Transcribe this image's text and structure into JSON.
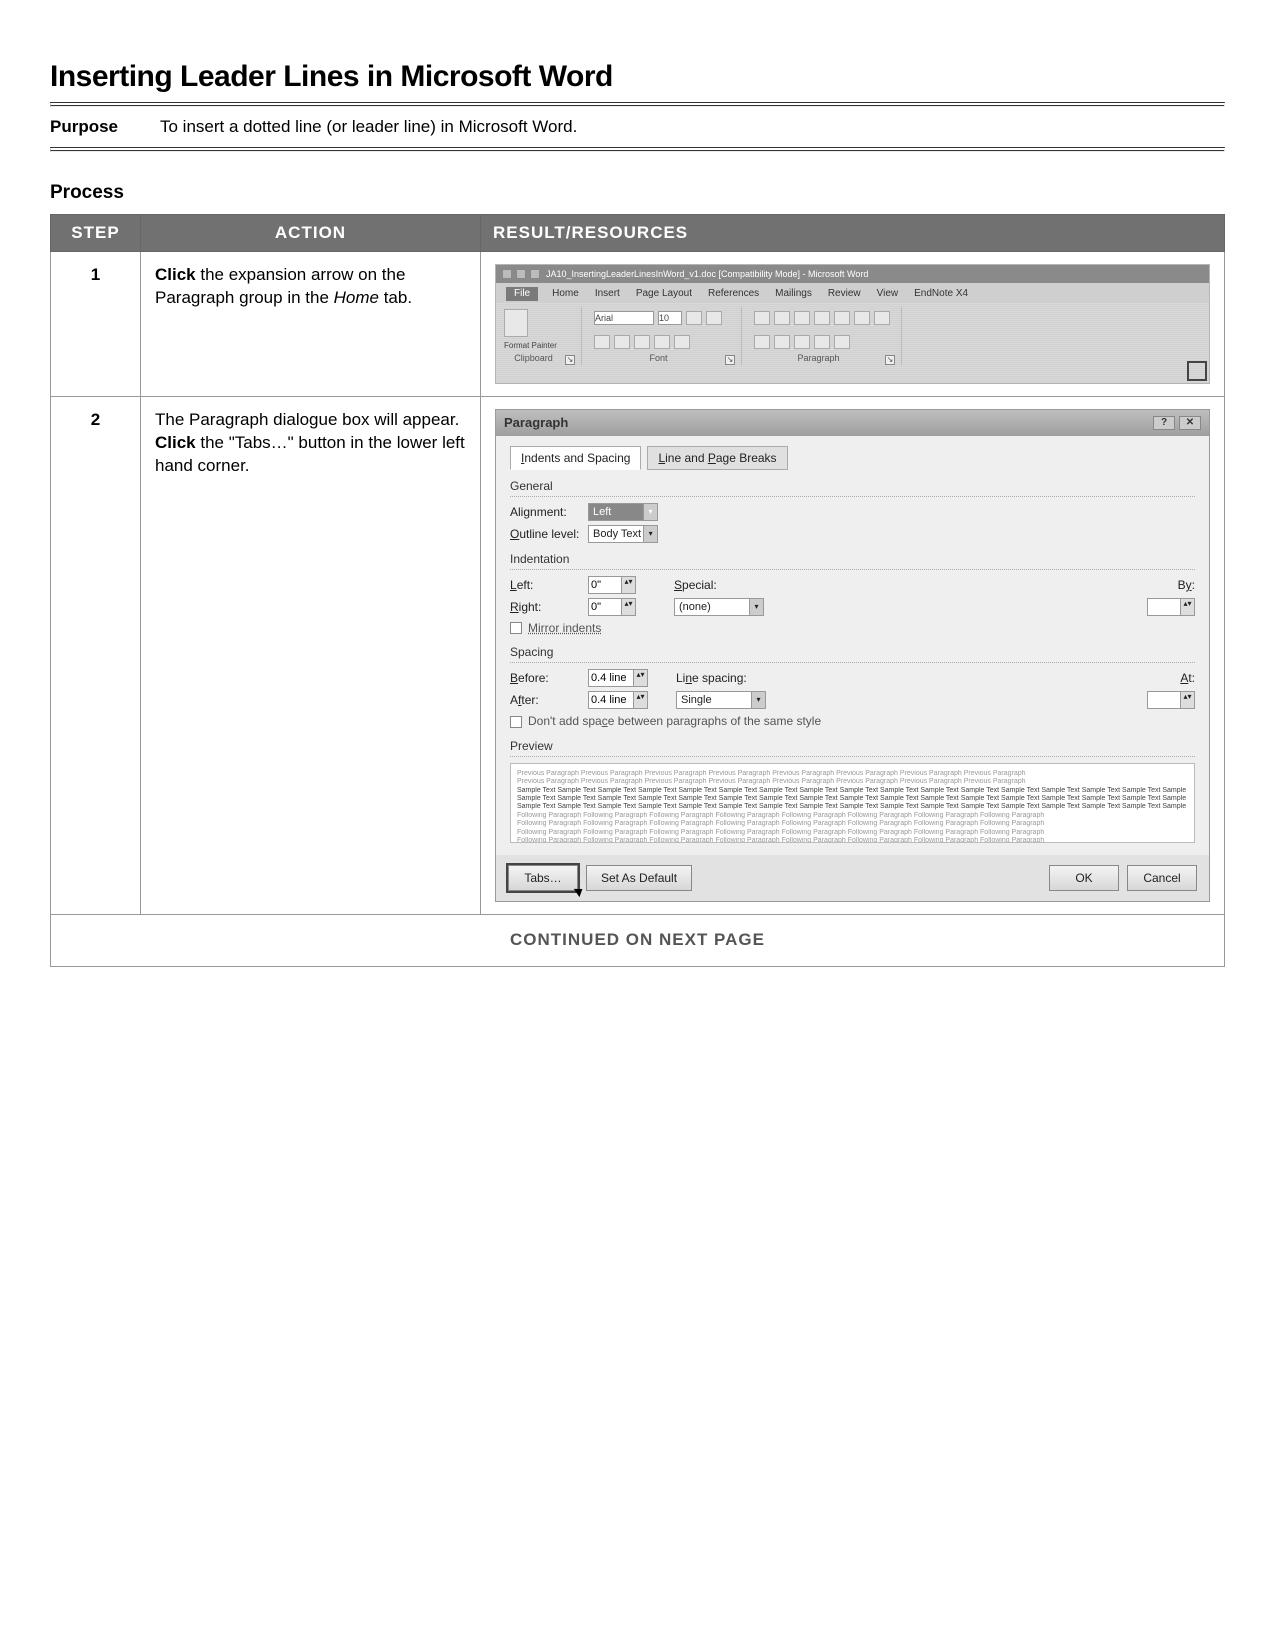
{
  "title": "Inserting Leader Lines in Microsoft Word",
  "purpose": {
    "label": "Purpose",
    "text": "To insert a dotted line (or leader line) in Microsoft Word."
  },
  "process": {
    "heading": "Process"
  },
  "table": {
    "headers": {
      "step": "STEP",
      "action": "ACTION",
      "result": "RESULT/RESOURCES"
    },
    "continued": "CONTINUED ON NEXT PAGE"
  },
  "steps": {
    "s1": {
      "num": "1",
      "action_pre": "Click",
      "action_mid": " the expansion arrow on the Paragraph group in the ",
      "action_ital": "Home",
      "action_post": " tab.",
      "ribbon": {
        "doc_title": "JA10_InsertingLeaderLinesInWord_v1.doc [Compatibility Mode] - Microsoft Word",
        "tabs": {
          "file": "File",
          "home": "Home",
          "insert": "Insert",
          "pagelayout": "Page Layout",
          "references": "References",
          "mailings": "Mailings",
          "review": "Review",
          "view": "View",
          "endnote": "EndNote X4"
        },
        "clipboard": {
          "format_painter": "Format Painter",
          "label": "Clipboard"
        },
        "font": {
          "name": "Arial",
          "size": "10",
          "label": "Font"
        },
        "paragraph": {
          "label": "Paragraph"
        }
      }
    },
    "s2": {
      "num": "2",
      "action_line1": "The Paragraph dialogue box will appear.",
      "action_pre": "Click",
      "action_post": " the \"Tabs…\" button in the lower left hand corner.",
      "dlg": {
        "title": "Paragraph",
        "tab1": "Indents and Spacing",
        "tab2": "Line and Page Breaks",
        "general": {
          "label": "General",
          "alignment": {
            "label": "Alignment:",
            "value": "Left"
          },
          "outline": {
            "label": "Outline level:",
            "value": "Body Text"
          }
        },
        "indentation": {
          "label": "Indentation",
          "left": {
            "label": "Left:",
            "value": "0\""
          },
          "right": {
            "label": "Right:",
            "value": "0\""
          },
          "special": {
            "label": "Special:",
            "value": "(none)"
          },
          "by": {
            "label": "By:",
            "value": ""
          },
          "mirror": "Mirror indents"
        },
        "spacing": {
          "label": "Spacing",
          "before": {
            "label": "Before:",
            "value": "0.4 line"
          },
          "after": {
            "label": "After:",
            "value": "0.4 line"
          },
          "linespacing": {
            "label": "Line spacing:",
            "value": "Single"
          },
          "at": {
            "label": "At:",
            "value": ""
          },
          "dontadd": "Don't add space between paragraphs of the same style"
        },
        "preview": {
          "label": "Preview",
          "prev_para": "Previous Paragraph Previous Paragraph Previous Paragraph Previous Paragraph Previous Paragraph Previous Paragraph Previous Paragraph Previous Paragraph",
          "sample": "Sample Text Sample Text Sample Text Sample Text Sample Text Sample Text Sample Text Sample Text Sample Text Sample Text Sample Text Sample Text Sample Text Sample Text Sample Text Sample Text Sample Text",
          "foll_para": "Following Paragraph Following Paragraph Following Paragraph Following Paragraph Following Paragraph Following Paragraph Following Paragraph Following Paragraph"
        },
        "buttons": {
          "tabs": "Tabs…",
          "default": "Set As Default",
          "ok": "OK",
          "cancel": "Cancel"
        }
      }
    }
  }
}
